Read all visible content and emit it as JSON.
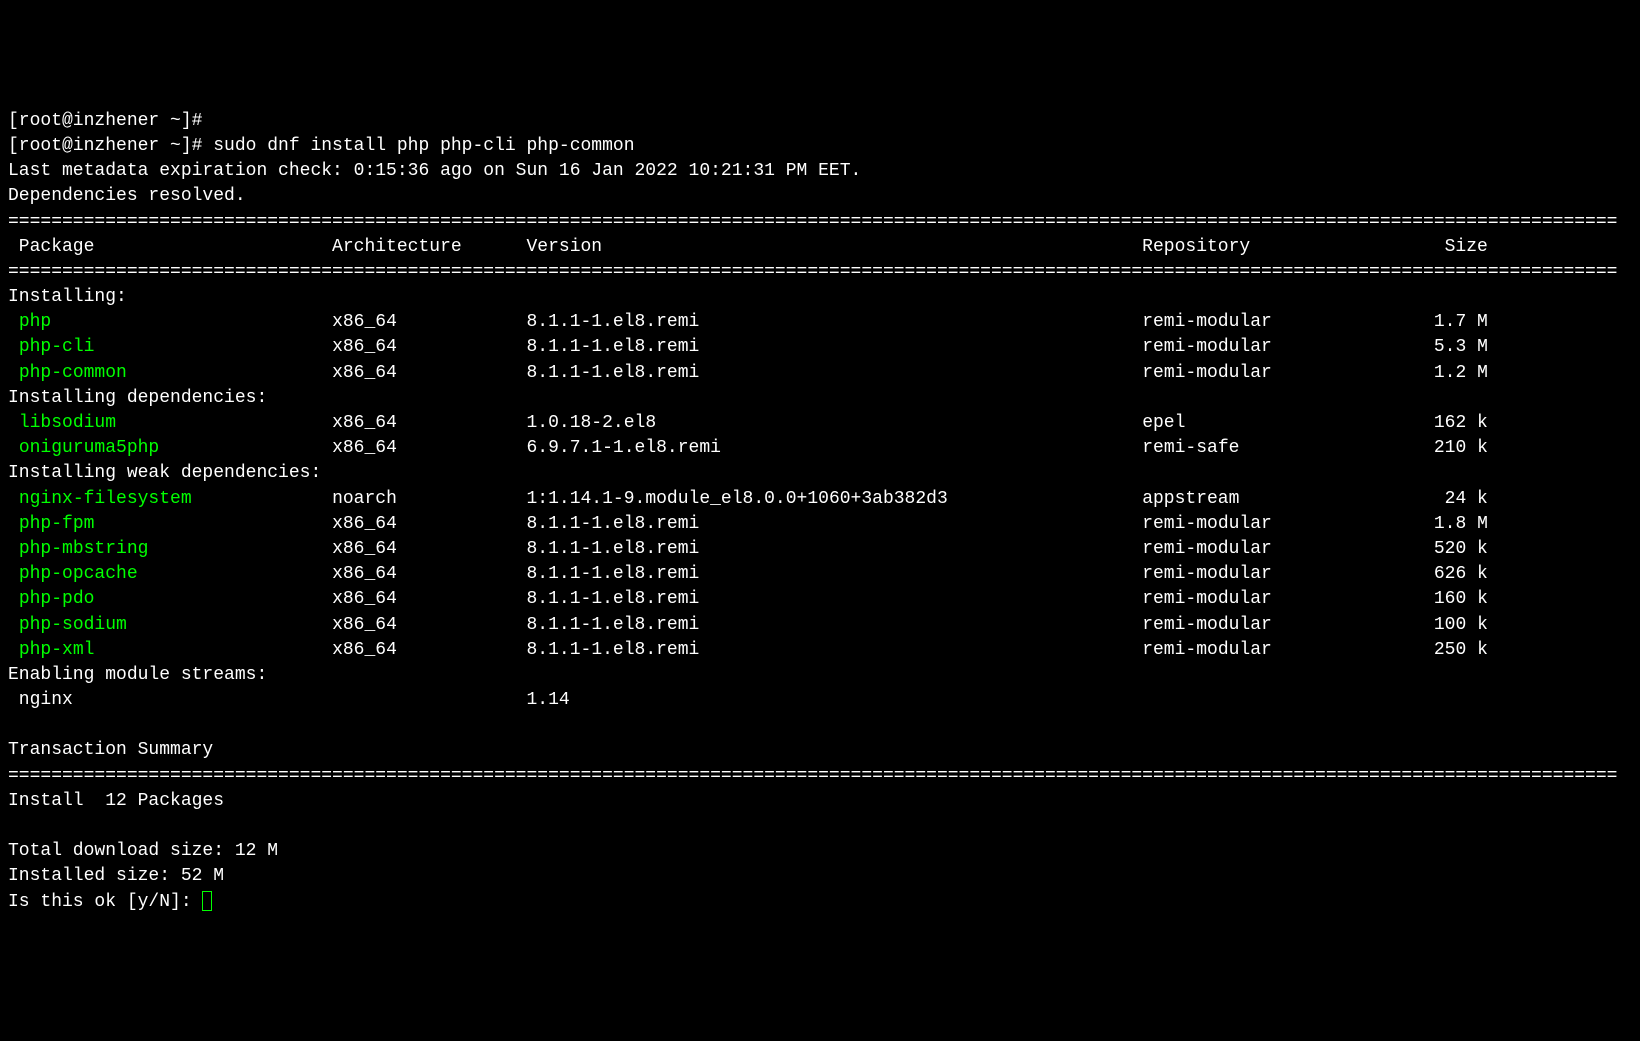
{
  "prompts": {
    "empty": "[root@inzhener ~]#",
    "command_prompt": "[root@inzhener ~]# ",
    "command": "sudo dnf install php php-cli php-common"
  },
  "output": {
    "metadata": "Last metadata expiration check: 0:15:36 ago on Sun 16 Jan 2022 10:21:31 PM EET.",
    "deps_resolved": "Dependencies resolved."
  },
  "headers": {
    "package": " Package",
    "arch": "Architecture",
    "version": "Version",
    "repo": "Repository",
    "size": "Size"
  },
  "sections": {
    "installing": "Installing:",
    "installing_deps": "Installing dependencies:",
    "installing_weak": "Installing weak dependencies:",
    "enabling_module": "Enabling module streams:",
    "transaction_summary": "Transaction Summary"
  },
  "packages": {
    "installing": [
      {
        "name": "php",
        "arch": "x86_64",
        "version": "8.1.1-1.el8.remi",
        "repo": "remi-modular",
        "size": "1.7 M"
      },
      {
        "name": "php-cli",
        "arch": "x86_64",
        "version": "8.1.1-1.el8.remi",
        "repo": "remi-modular",
        "size": "5.3 M"
      },
      {
        "name": "php-common",
        "arch": "x86_64",
        "version": "8.1.1-1.el8.remi",
        "repo": "remi-modular",
        "size": "1.2 M"
      }
    ],
    "deps": [
      {
        "name": "libsodium",
        "arch": "x86_64",
        "version": "1.0.18-2.el8",
        "repo": "epel",
        "size": "162 k"
      },
      {
        "name": "oniguruma5php",
        "arch": "x86_64",
        "version": "6.9.7.1-1.el8.remi",
        "repo": "remi-safe",
        "size": "210 k"
      }
    ],
    "weak_deps": [
      {
        "name": "nginx-filesystem",
        "arch": "noarch",
        "version": "1:1.14.1-9.module_el8.0.0+1060+3ab382d3",
        "repo": "appstream",
        "size": "24 k"
      },
      {
        "name": "php-fpm",
        "arch": "x86_64",
        "version": "8.1.1-1.el8.remi",
        "repo": "remi-modular",
        "size": "1.8 M"
      },
      {
        "name": "php-mbstring",
        "arch": "x86_64",
        "version": "8.1.1-1.el8.remi",
        "repo": "remi-modular",
        "size": "520 k"
      },
      {
        "name": "php-opcache",
        "arch": "x86_64",
        "version": "8.1.1-1.el8.remi",
        "repo": "remi-modular",
        "size": "626 k"
      },
      {
        "name": "php-pdo",
        "arch": "x86_64",
        "version": "8.1.1-1.el8.remi",
        "repo": "remi-modular",
        "size": "160 k"
      },
      {
        "name": "php-sodium",
        "arch": "x86_64",
        "version": "8.1.1-1.el8.remi",
        "repo": "remi-modular",
        "size": "100 k"
      },
      {
        "name": "php-xml",
        "arch": "x86_64",
        "version": "8.1.1-1.el8.remi",
        "repo": "remi-modular",
        "size": "250 k"
      }
    ],
    "modules": [
      {
        "name": "nginx",
        "version": "1.14"
      }
    ]
  },
  "summary": {
    "install_line": "Install  12 Packages",
    "download_size": "Total download size: 12 M",
    "installed_size": "Installed size: 52 M",
    "prompt": "Is this ok [y/N]: "
  },
  "divider": "====================================================================================================================================================="
}
